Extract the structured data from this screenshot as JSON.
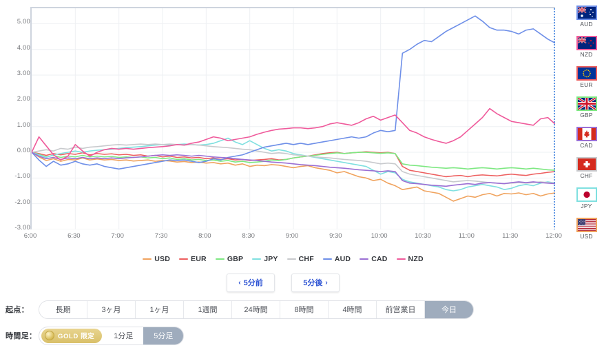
{
  "chart_data": {
    "type": "line",
    "title": "",
    "xlabel": "",
    "ylabel": "",
    "ylim": [
      -3,
      5.6
    ],
    "xlim": [
      "6:00",
      "12:00"
    ],
    "grid": true,
    "legend_position": "bottom",
    "y_ticks": [
      "5.00",
      "4.00",
      "3.00",
      "2.00",
      "1.00",
      "0.00",
      "-1.00",
      "-2.00",
      "-3.00"
    ],
    "y_tick_values": [
      5,
      4,
      3,
      2,
      1,
      0,
      -1,
      -2,
      -3
    ],
    "x_ticks": [
      "6:00",
      "6:30",
      "7:00",
      "7:30",
      "8:00",
      "8:30",
      "9:00",
      "9:30",
      "10:00",
      "10:30",
      "11:00",
      "11:30",
      "12:00"
    ],
    "series": [
      {
        "name": "USD",
        "color": "#f0a35e",
        "values": [
          0.0,
          -0.18,
          -0.32,
          -0.25,
          -0.35,
          -0.28,
          -0.3,
          -0.22,
          -0.3,
          -0.26,
          -0.3,
          -0.28,
          -0.32,
          -0.3,
          -0.34,
          -0.32,
          -0.3,
          -0.35,
          -0.32,
          -0.34,
          -0.38,
          -0.36,
          -0.4,
          -0.38,
          -0.42,
          -0.4,
          -0.45,
          -0.42,
          -0.5,
          -0.45,
          -0.55,
          -0.5,
          -0.52,
          -0.48,
          -0.5,
          -0.55,
          -0.6,
          -0.55,
          -0.52,
          -0.6,
          -0.65,
          -0.7,
          -0.8,
          -0.75,
          -0.85,
          -0.95,
          -1.0,
          -1.1,
          -1.05,
          -1.2,
          -1.3,
          -1.45,
          -1.4,
          -1.35,
          -1.5,
          -1.55,
          -1.6,
          -1.75,
          -1.9,
          -1.8,
          -1.7,
          -1.75,
          -1.65,
          -1.6,
          -1.7,
          -1.6,
          -1.62,
          -1.58,
          -1.65,
          -1.6,
          -1.7,
          -1.62,
          -1.58
        ]
      },
      {
        "name": "EUR",
        "color": "#ed5e5e",
        "values": [
          0.0,
          -0.05,
          -0.12,
          -0.05,
          -0.1,
          -0.05,
          -0.08,
          -0.02,
          -0.1,
          -0.05,
          -0.08,
          -0.06,
          -0.1,
          -0.08,
          -0.12,
          -0.1,
          -0.15,
          -0.12,
          -0.18,
          -0.15,
          -0.2,
          -0.18,
          -0.22,
          -0.2,
          -0.25,
          -0.22,
          -0.28,
          -0.25,
          -0.3,
          -0.28,
          -0.32,
          -0.3,
          -0.28,
          -0.25,
          -0.3,
          -0.28,
          -0.22,
          -0.18,
          -0.15,
          -0.1,
          -0.05,
          -0.02,
          0.0,
          -0.05,
          -0.02,
          0.0,
          0.02,
          0.0,
          -0.02,
          0.0,
          -0.05,
          -0.55,
          -0.7,
          -0.75,
          -0.8,
          -0.85,
          -0.9,
          -0.95,
          -0.92,
          -0.9,
          -0.95,
          -0.9,
          -0.88,
          -0.9,
          -0.92,
          -0.88,
          -0.85,
          -0.88,
          -0.9,
          -0.85,
          -0.82,
          -0.78,
          -0.75
        ]
      },
      {
        "name": "GBP",
        "color": "#7ee882",
        "values": [
          0.0,
          -0.08,
          -0.18,
          -0.12,
          -0.2,
          -0.15,
          -0.18,
          -0.12,
          -0.18,
          -0.15,
          -0.18,
          -0.16,
          -0.2,
          -0.18,
          -0.2,
          -0.18,
          -0.22,
          -0.2,
          -0.25,
          -0.22,
          -0.28,
          -0.25,
          -0.3,
          -0.28,
          -0.32,
          -0.3,
          -0.35,
          -0.32,
          -0.38,
          -0.35,
          -0.4,
          -0.38,
          -0.35,
          -0.3,
          -0.32,
          -0.28,
          -0.22,
          -0.18,
          -0.15,
          -0.12,
          -0.08,
          -0.05,
          -0.02,
          -0.05,
          -0.02,
          0.0,
          0.0,
          -0.02,
          -0.04,
          -0.02,
          -0.05,
          -0.45,
          -0.5,
          -0.52,
          -0.55,
          -0.58,
          -0.6,
          -0.62,
          -0.6,
          -0.62,
          -0.65,
          -0.62,
          -0.6,
          -0.62,
          -0.65,
          -0.62,
          -0.6,
          -0.62,
          -0.65,
          -0.62,
          -0.65,
          -0.68,
          -0.7
        ]
      },
      {
        "name": "JPY",
        "color": "#7fe0e0",
        "values": [
          0.0,
          -0.1,
          -0.2,
          -0.1,
          -0.05,
          0.0,
          0.05,
          0.0,
          0.05,
          0.08,
          0.1,
          0.12,
          0.15,
          0.18,
          0.2,
          0.22,
          0.25,
          0.28,
          0.3,
          0.28,
          0.3,
          0.32,
          0.3,
          0.28,
          0.3,
          0.35,
          0.45,
          0.55,
          0.4,
          0.3,
          0.45,
          0.3,
          0.15,
          0.05,
          0.1,
          0.05,
          -0.05,
          -0.1,
          -0.15,
          -0.2,
          -0.25,
          -0.3,
          -0.35,
          -0.4,
          -0.45,
          -0.5,
          -0.55,
          -0.7,
          -0.85,
          -0.75,
          -0.8,
          -1.05,
          -1.15,
          -1.2,
          -1.25,
          -1.3,
          -1.35,
          -1.45,
          -1.5,
          -1.45,
          -1.35,
          -1.3,
          -1.25,
          -1.3,
          -1.35,
          -1.45,
          -1.4,
          -1.3,
          -1.25,
          -1.3,
          -1.2,
          -1.15,
          -1.2
        ]
      },
      {
        "name": "CHF",
        "color": "#c8cacd",
        "values": [
          0.0,
          0.05,
          0.1,
          0.05,
          0.15,
          0.12,
          0.2,
          0.15,
          0.2,
          0.22,
          0.25,
          0.28,
          0.3,
          0.28,
          0.3,
          0.32,
          0.3,
          0.32,
          0.3,
          0.32,
          0.3,
          0.28,
          0.3,
          0.28,
          0.25,
          0.22,
          0.2,
          0.18,
          0.15,
          0.12,
          0.1,
          0.05,
          0.0,
          -0.05,
          -0.02,
          -0.05,
          -0.1,
          -0.12,
          -0.15,
          -0.18,
          -0.2,
          -0.22,
          -0.25,
          -0.28,
          -0.3,
          -0.32,
          -0.35,
          -0.4,
          -0.45,
          -0.42,
          -0.45,
          -0.75,
          -0.85,
          -0.9,
          -0.95,
          -1.0,
          -1.05,
          -1.1,
          -1.15,
          -1.12,
          -1.1,
          -1.12,
          -1.15,
          -1.18,
          -1.2,
          -1.22,
          -1.2,
          -1.18,
          -1.2,
          -1.18,
          -1.15,
          -1.18,
          -1.2
        ]
      },
      {
        "name": "AUD",
        "color": "#6e8fe8",
        "values": [
          0.0,
          -0.3,
          -0.55,
          -0.35,
          -0.5,
          -0.45,
          -0.35,
          -0.45,
          -0.5,
          -0.45,
          -0.55,
          -0.6,
          -0.65,
          -0.6,
          -0.55,
          -0.5,
          -0.45,
          -0.4,
          -0.35,
          -0.3,
          -0.32,
          -0.3,
          -0.35,
          -0.4,
          -0.35,
          -0.25,
          -0.3,
          -0.2,
          -0.15,
          -0.1,
          0.0,
          0.1,
          0.2,
          0.25,
          0.3,
          0.35,
          0.3,
          0.35,
          0.3,
          0.35,
          0.4,
          0.45,
          0.5,
          0.55,
          0.6,
          0.55,
          0.6,
          0.75,
          0.85,
          0.8,
          0.85,
          3.85,
          4.0,
          4.2,
          4.35,
          4.3,
          4.5,
          4.7,
          4.85,
          5.0,
          5.15,
          5.3,
          5.1,
          4.85,
          4.75,
          4.75,
          4.7,
          4.6,
          4.75,
          4.8,
          4.6,
          4.4,
          4.25
        ]
      },
      {
        "name": "CAD",
        "color": "#9b6fd4",
        "values": [
          0.0,
          -0.15,
          -0.25,
          -0.2,
          -0.28,
          -0.22,
          -0.25,
          -0.2,
          -0.25,
          -0.22,
          -0.25,
          -0.22,
          -0.25,
          -0.22,
          -0.2,
          -0.18,
          -0.15,
          -0.12,
          -0.1,
          -0.12,
          -0.1,
          -0.12,
          -0.15,
          -0.12,
          -0.15,
          -0.18,
          -0.2,
          -0.22,
          -0.25,
          -0.28,
          -0.3,
          -0.32,
          -0.35,
          -0.38,
          -0.4,
          -0.42,
          -0.45,
          -0.48,
          -0.5,
          -0.52,
          -0.55,
          -0.58,
          -0.6,
          -0.62,
          -0.65,
          -0.68,
          -0.7,
          -0.72,
          -0.75,
          -0.72,
          -0.75,
          -1.1,
          -1.2,
          -1.22,
          -1.25,
          -1.28,
          -1.3,
          -1.32,
          -1.28,
          -1.25,
          -1.22,
          -1.25,
          -1.2,
          -1.18,
          -1.2,
          -1.22,
          -1.18,
          -1.15,
          -1.18,
          -1.15,
          -1.18,
          -1.2,
          -1.22
        ]
      },
      {
        "name": "NZD",
        "color": "#ef5a9b",
        "values": [
          0.0,
          0.6,
          0.25,
          -0.1,
          -0.3,
          -0.15,
          0.3,
          0.05,
          -0.15,
          0.0,
          0.1,
          0.15,
          0.12,
          0.15,
          0.12,
          0.15,
          0.18,
          0.2,
          0.22,
          0.25,
          0.3,
          0.28,
          0.35,
          0.4,
          0.5,
          0.6,
          0.55,
          0.45,
          0.5,
          0.55,
          0.6,
          0.7,
          0.78,
          0.85,
          0.9,
          0.92,
          0.95,
          0.95,
          0.92,
          0.95,
          1.0,
          1.1,
          1.15,
          1.1,
          1.05,
          1.15,
          1.3,
          1.4,
          1.25,
          1.35,
          1.45,
          1.15,
          0.85,
          0.75,
          0.6,
          0.5,
          0.42,
          0.35,
          0.45,
          0.6,
          0.85,
          1.1,
          1.35,
          1.7,
          1.5,
          1.35,
          1.2,
          1.15,
          1.1,
          1.05,
          1.3,
          1.35,
          1.1
        ]
      }
    ]
  },
  "flags": [
    {
      "code": "AUD",
      "border": "#6e8fe8"
    },
    {
      "code": "NZD",
      "border": "#ef5a9b"
    },
    {
      "code": "EUR",
      "border": "#ed5e5e"
    },
    {
      "code": "GBP",
      "border": "#7ee882"
    },
    {
      "code": "CAD",
      "border": "#9b6fd4"
    },
    {
      "code": "CHF",
      "border": "#c8cacd"
    },
    {
      "code": "JPY",
      "border": "#7fe0e0"
    },
    {
      "code": "USD",
      "border": "#f0a35e"
    }
  ],
  "nav": {
    "prev_label": "5分前",
    "next_label": "5分後",
    "prev_chevron": "‹",
    "next_chevron": "›"
  },
  "origin_row": {
    "label": "起点：",
    "items": [
      {
        "label": "長期",
        "active": false
      },
      {
        "label": "3ヶ月",
        "active": false
      },
      {
        "label": "1ヶ月",
        "active": false
      },
      {
        "label": "1週間",
        "active": false
      },
      {
        "label": "24時間",
        "active": false
      },
      {
        "label": "8時間",
        "active": false
      },
      {
        "label": "4時間",
        "active": false
      },
      {
        "label": "前営業日",
        "active": false
      },
      {
        "label": "今日",
        "active": true
      }
    ]
  },
  "timeframe_row": {
    "label": "時間足：",
    "gold_badge": "GOLD 限定",
    "items": [
      {
        "label": "1分足",
        "active": false
      },
      {
        "label": "5分足",
        "active": true
      }
    ]
  },
  "colors": {
    "accent_blue": "#2f55d4",
    "active_bg": "#9facbd",
    "grid": "#eef0f3",
    "axis_border": "#ced4de",
    "dotted_marker": "#3b7fe0"
  }
}
